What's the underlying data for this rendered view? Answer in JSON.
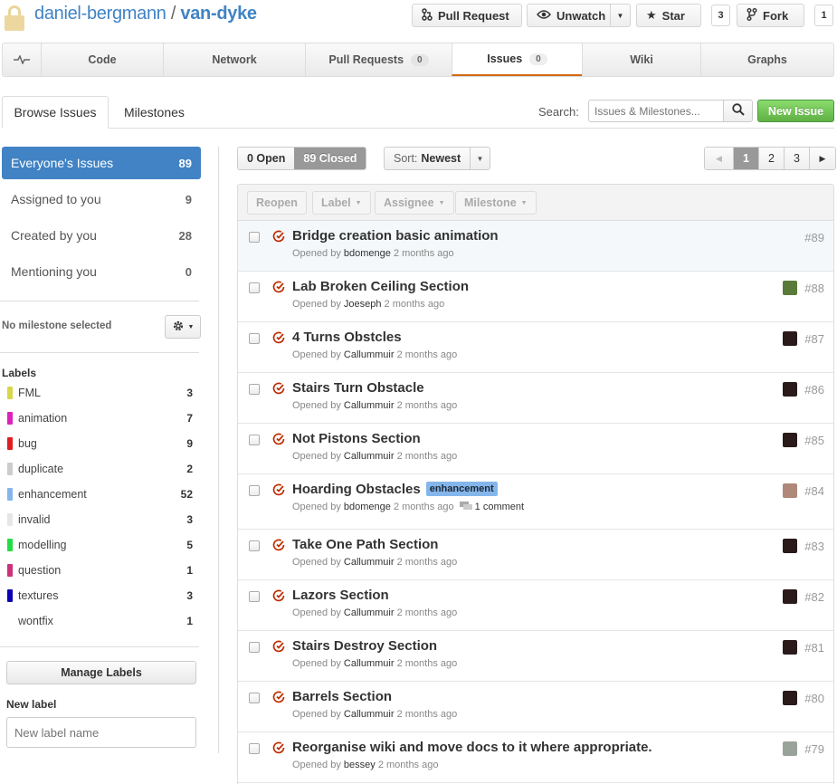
{
  "header": {
    "owner": "daniel-bergmann",
    "separator": "/",
    "repo": "van-dyke",
    "pull_request_label": "Pull Request",
    "unwatch_label": "Unwatch",
    "star_label": "Star",
    "star_count": "3",
    "fork_label": "Fork",
    "fork_count": "1"
  },
  "nav": {
    "tabs": [
      {
        "label": "Code"
      },
      {
        "label": "Network"
      },
      {
        "label": "Pull Requests",
        "count": "0"
      },
      {
        "label": "Issues",
        "count": "0"
      },
      {
        "label": "Wiki"
      },
      {
        "label": "Graphs"
      }
    ]
  },
  "subnav": {
    "browse": "Browse Issues",
    "milestones": "Milestones",
    "search_label": "Search:",
    "search_placeholder": "Issues & Milestones...",
    "new_issue": "New Issue"
  },
  "filters": [
    {
      "label": "Everyone's Issues",
      "count": "89"
    },
    {
      "label": "Assigned to you",
      "count": "9"
    },
    {
      "label": "Created by you",
      "count": "28"
    },
    {
      "label": "Mentioning you",
      "count": "0"
    }
  ],
  "milestone": {
    "label": "No milestone selected"
  },
  "labels_section": {
    "heading": "Labels",
    "items": [
      {
        "name": "FML",
        "count": "3",
        "color": "#d8d64a"
      },
      {
        "name": "animation",
        "count": "7",
        "color": "#dd22bb"
      },
      {
        "name": "bug",
        "count": "9",
        "color": "#e11d21"
      },
      {
        "name": "duplicate",
        "count": "2",
        "color": "#cccccc"
      },
      {
        "name": "enhancement",
        "count": "52",
        "color": "#84b6eb"
      },
      {
        "name": "invalid",
        "count": "3",
        "color": "#e6e6e6"
      },
      {
        "name": "modelling",
        "count": "5",
        "color": "#22dd44"
      },
      {
        "name": "question",
        "count": "1",
        "color": "#cc317c"
      },
      {
        "name": "textures",
        "count": "3",
        "color": "#0b02b5"
      },
      {
        "name": "wontfix",
        "count": "1",
        "color": "#ffffff"
      }
    ],
    "manage": "Manage Labels",
    "new_label_heading": "New label",
    "new_label_placeholder": "New label name"
  },
  "toolbar": {
    "open": "0 Open",
    "closed": "89 Closed",
    "sort_prefix": "Sort:",
    "sort_value": "Newest",
    "pages": [
      "1",
      "2",
      "3"
    ],
    "prev": "◀",
    "next": "▶"
  },
  "bulk": {
    "reopen": "Reopen",
    "label": "Label",
    "assignee": "Assignee",
    "milestone": "Milestone"
  },
  "issues": [
    {
      "title": "Bridge creation basic animation",
      "opened_by": "Opened by",
      "user": "bdomenge",
      "ago": "2 months ago",
      "number": "#89",
      "avatar": null
    },
    {
      "title": "Lab Broken Ceiling Section",
      "opened_by": "Opened by",
      "user": "Joeseph",
      "ago": "2 months ago",
      "number": "#88",
      "avatar": "#5a7a3a"
    },
    {
      "title": "4 Turns Obstcles",
      "opened_by": "Opened by",
      "user": "Callummuir",
      "ago": "2 months ago",
      "number": "#87",
      "avatar": "#2a1a1a"
    },
    {
      "title": "Stairs Turn Obstacle",
      "opened_by": "Opened by",
      "user": "Callummuir",
      "ago": "2 months ago",
      "number": "#86",
      "avatar": "#2a1a1a"
    },
    {
      "title": "Not Pistons Section",
      "opened_by": "Opened by",
      "user": "Callummuir",
      "ago": "2 months ago",
      "number": "#85",
      "avatar": "#2a1a1a"
    },
    {
      "title": "Hoarding Obstacles",
      "label": "enhancement",
      "opened_by": "Opened by",
      "user": "bdomenge",
      "ago": "2 months ago",
      "comments": "1 comment",
      "number": "#84",
      "avatar": "#b0887a"
    },
    {
      "title": "Take One Path Section",
      "opened_by": "Opened by",
      "user": "Callummuir",
      "ago": "2 months ago",
      "number": "#83",
      "avatar": "#2a1a1a"
    },
    {
      "title": "Lazors Section",
      "opened_by": "Opened by",
      "user": "Callummuir",
      "ago": "2 months ago",
      "number": "#82",
      "avatar": "#2a1a1a"
    },
    {
      "title": "Stairs Destroy Section",
      "opened_by": "Opened by",
      "user": "Callummuir",
      "ago": "2 months ago",
      "number": "#81",
      "avatar": "#2a1a1a"
    },
    {
      "title": "Barrels Section",
      "opened_by": "Opened by",
      "user": "Callummuir",
      "ago": "2 months ago",
      "number": "#80",
      "avatar": "#2a1a1a"
    },
    {
      "title": "Reorganise wiki and move docs to it where appropriate.",
      "opened_by": "Opened by",
      "user": "bessey",
      "ago": "2 months ago",
      "number": "#79",
      "avatar": "#9aa39a"
    }
  ],
  "colors": {
    "accent": "#4183c4",
    "closed_icon": "#bd2c00",
    "new_issue_green": "#60b044",
    "active_tab_border": "#d26911"
  }
}
